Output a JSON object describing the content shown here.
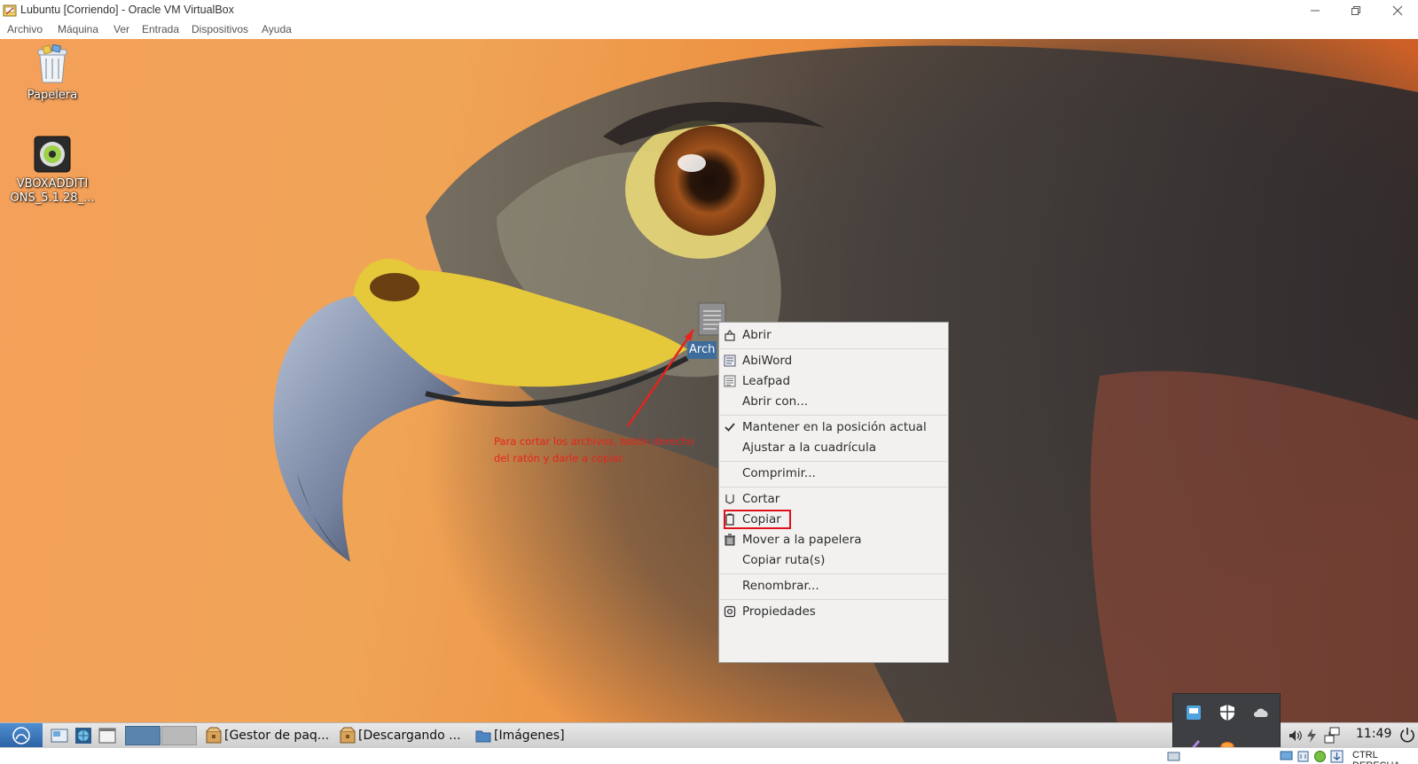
{
  "window": {
    "title": "Lubuntu [Corriendo] - Oracle VM VirtualBox",
    "icons": [
      "virtualbox-app-icon",
      "minimize-icon",
      "restore-icon",
      "close-icon"
    ]
  },
  "menubar": {
    "items": [
      "Archivo",
      "Máquina",
      "Ver",
      "Entrada",
      "Dispositivos",
      "Ayuda"
    ]
  },
  "desktop": {
    "icons": [
      {
        "label": "Papelera",
        "icon": "trash-icon"
      },
      {
        "label_line1": "VBOXADDITI",
        "label_line2": "ONS_5.1.28_...",
        "icon": "disc-icon"
      }
    ],
    "selected_file_label": "Arch",
    "annotation": {
      "line1": "Para cortar los archivos, botón derecho",
      "line2": "del ratón y darle a copiar."
    },
    "colors": {
      "annotation": "#e8231b",
      "highlight_box": "#e0101a",
      "selection": "#3e6d9c"
    }
  },
  "context_menu": {
    "groups": [
      [
        {
          "label": "Abrir",
          "icon": "open-icon"
        }
      ],
      [
        {
          "label": "AbiWord",
          "icon": "abiword-icon"
        },
        {
          "label": "Leafpad",
          "icon": "leafpad-icon"
        },
        {
          "label": "Abrir con...",
          "icon": ""
        }
      ],
      [
        {
          "label": "Mantener en la posición actual",
          "icon": "check-icon"
        },
        {
          "label": "Ajustar a la cuadrícula",
          "icon": ""
        }
      ],
      [
        {
          "label": "Comprimir...",
          "icon": ""
        }
      ],
      [
        {
          "label": "Cortar",
          "icon": "cut-icon"
        },
        {
          "label": "Copiar",
          "icon": "copy-icon"
        },
        {
          "label": "Mover a la papelera",
          "icon": "trash-icon"
        },
        {
          "label": "Copiar ruta(s)",
          "icon": ""
        }
      ],
      [
        {
          "label": "Renombrar...",
          "icon": ""
        }
      ],
      [
        {
          "label": "Propiedades",
          "icon": "properties-icon"
        }
      ]
    ]
  },
  "taskbar": {
    "tasks": [
      {
        "label": "[Gestor de paq...",
        "icon": "package-manager-icon"
      },
      {
        "label": "[Descargando ...",
        "icon": "download-icon"
      },
      {
        "label": "[Imágenes]",
        "icon": "folder-icon"
      }
    ],
    "clock": "11:49",
    "icons": [
      "lubuntu-menu-icon",
      "show-desktop-icon",
      "network-browser-icon",
      "window-icon",
      "volume-icon",
      "power-icon",
      "network-icon",
      "shutdown-icon"
    ]
  },
  "tray_popup": {
    "icons": [
      "tray-app-icon",
      "shield-icon",
      "cloud-icon",
      "pen-icon",
      "tray-orange-icon"
    ]
  },
  "statusbar": {
    "host_key": "CTRL DERECHA"
  }
}
